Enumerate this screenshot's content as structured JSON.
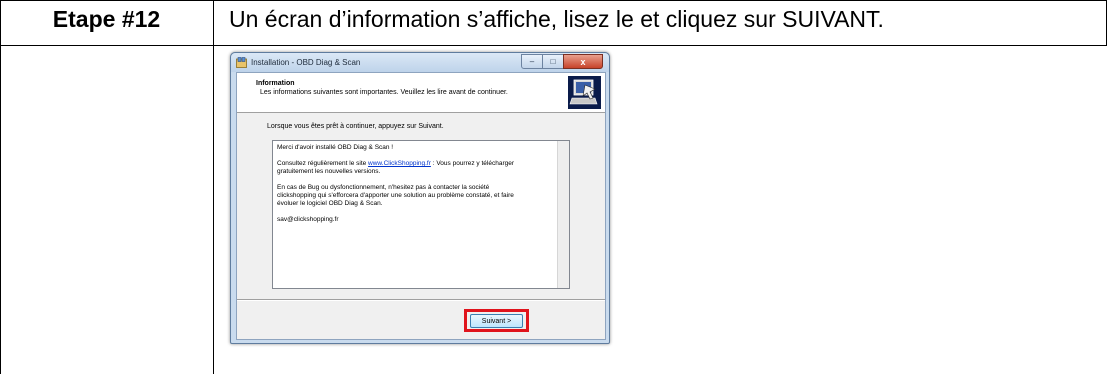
{
  "step": {
    "label": "Etape #12",
    "instruction": "Un écran d’information s’affiche, lisez le et cliquez sur SUIVANT."
  },
  "window": {
    "title": "Installation - OBD Diag & Scan",
    "controls": {
      "minimize": "–",
      "maximize": "□",
      "close": "x"
    },
    "header_title": "Information",
    "header_subtitle": "Les informations suivantes sont importantes. Veuillez les lire avant de continuer.",
    "intro": "Lorsque vous êtes prêt à continuer, appuyez sur Suivant.",
    "memo": {
      "line1": "Merci d'avoir installé OBD Diag & Scan !",
      "line2_before": "Consultez régulièrement le site ",
      "line2_link": "www.ClickShopping.fr",
      "line2_after": " : Vous pourrez y télécharger",
      "line3": "gratuitement les nouvelles versions.",
      "line4": "En cas de Bug ou dysfonctionnement, n'hesitez pas à contacter la société",
      "line5": "clickshopping qui s'efforcera  d'apporter une solution au problème constaté, et faire",
      "line6": "évoluer le logiciel OBD Diag & Scan.",
      "line7": "sav@clickshopping.fr"
    },
    "next_button": "Suivant >",
    "highlight_color": "#e0141c",
    "icons": {
      "app": "installer-icon",
      "header": "computer-install-icon"
    }
  }
}
